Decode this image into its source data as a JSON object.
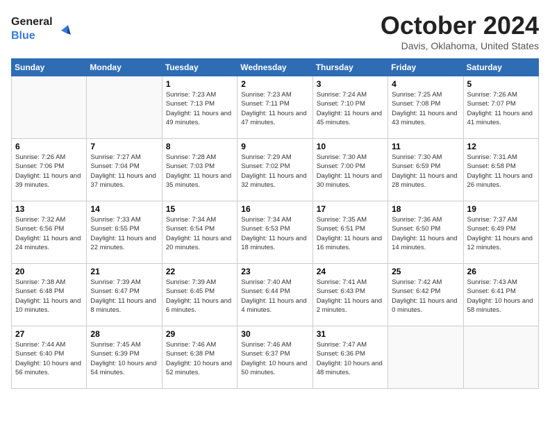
{
  "header": {
    "logo_general": "General",
    "logo_blue": "Blue",
    "title": "October 2024",
    "location": "Davis, Oklahoma, United States"
  },
  "weekdays": [
    "Sunday",
    "Monday",
    "Tuesday",
    "Wednesday",
    "Thursday",
    "Friday",
    "Saturday"
  ],
  "weeks": [
    [
      {
        "day": "",
        "info": ""
      },
      {
        "day": "",
        "info": ""
      },
      {
        "day": "1",
        "info": "Sunrise: 7:23 AM\nSunset: 7:13 PM\nDaylight: 11 hours and 49 minutes."
      },
      {
        "day": "2",
        "info": "Sunrise: 7:23 AM\nSunset: 7:11 PM\nDaylight: 11 hours and 47 minutes."
      },
      {
        "day": "3",
        "info": "Sunrise: 7:24 AM\nSunset: 7:10 PM\nDaylight: 11 hours and 45 minutes."
      },
      {
        "day": "4",
        "info": "Sunrise: 7:25 AM\nSunset: 7:08 PM\nDaylight: 11 hours and 43 minutes."
      },
      {
        "day": "5",
        "info": "Sunrise: 7:26 AM\nSunset: 7:07 PM\nDaylight: 11 hours and 41 minutes."
      }
    ],
    [
      {
        "day": "6",
        "info": "Sunrise: 7:26 AM\nSunset: 7:06 PM\nDaylight: 11 hours and 39 minutes."
      },
      {
        "day": "7",
        "info": "Sunrise: 7:27 AM\nSunset: 7:04 PM\nDaylight: 11 hours and 37 minutes."
      },
      {
        "day": "8",
        "info": "Sunrise: 7:28 AM\nSunset: 7:03 PM\nDaylight: 11 hours and 35 minutes."
      },
      {
        "day": "9",
        "info": "Sunrise: 7:29 AM\nSunset: 7:02 PM\nDaylight: 11 hours and 32 minutes."
      },
      {
        "day": "10",
        "info": "Sunrise: 7:30 AM\nSunset: 7:00 PM\nDaylight: 11 hours and 30 minutes."
      },
      {
        "day": "11",
        "info": "Sunrise: 7:30 AM\nSunset: 6:59 PM\nDaylight: 11 hours and 28 minutes."
      },
      {
        "day": "12",
        "info": "Sunrise: 7:31 AM\nSunset: 6:58 PM\nDaylight: 11 hours and 26 minutes."
      }
    ],
    [
      {
        "day": "13",
        "info": "Sunrise: 7:32 AM\nSunset: 6:56 PM\nDaylight: 11 hours and 24 minutes."
      },
      {
        "day": "14",
        "info": "Sunrise: 7:33 AM\nSunset: 6:55 PM\nDaylight: 11 hours and 22 minutes."
      },
      {
        "day": "15",
        "info": "Sunrise: 7:34 AM\nSunset: 6:54 PM\nDaylight: 11 hours and 20 minutes."
      },
      {
        "day": "16",
        "info": "Sunrise: 7:34 AM\nSunset: 6:53 PM\nDaylight: 11 hours and 18 minutes."
      },
      {
        "day": "17",
        "info": "Sunrise: 7:35 AM\nSunset: 6:51 PM\nDaylight: 11 hours and 16 minutes."
      },
      {
        "day": "18",
        "info": "Sunrise: 7:36 AM\nSunset: 6:50 PM\nDaylight: 11 hours and 14 minutes."
      },
      {
        "day": "19",
        "info": "Sunrise: 7:37 AM\nSunset: 6:49 PM\nDaylight: 11 hours and 12 minutes."
      }
    ],
    [
      {
        "day": "20",
        "info": "Sunrise: 7:38 AM\nSunset: 6:48 PM\nDaylight: 11 hours and 10 minutes."
      },
      {
        "day": "21",
        "info": "Sunrise: 7:39 AM\nSunset: 6:47 PM\nDaylight: 11 hours and 8 minutes."
      },
      {
        "day": "22",
        "info": "Sunrise: 7:39 AM\nSunset: 6:45 PM\nDaylight: 11 hours and 6 minutes."
      },
      {
        "day": "23",
        "info": "Sunrise: 7:40 AM\nSunset: 6:44 PM\nDaylight: 11 hours and 4 minutes."
      },
      {
        "day": "24",
        "info": "Sunrise: 7:41 AM\nSunset: 6:43 PM\nDaylight: 11 hours and 2 minutes."
      },
      {
        "day": "25",
        "info": "Sunrise: 7:42 AM\nSunset: 6:42 PM\nDaylight: 11 hours and 0 minutes."
      },
      {
        "day": "26",
        "info": "Sunrise: 7:43 AM\nSunset: 6:41 PM\nDaylight: 10 hours and 58 minutes."
      }
    ],
    [
      {
        "day": "27",
        "info": "Sunrise: 7:44 AM\nSunset: 6:40 PM\nDaylight: 10 hours and 56 minutes."
      },
      {
        "day": "28",
        "info": "Sunrise: 7:45 AM\nSunset: 6:39 PM\nDaylight: 10 hours and 54 minutes."
      },
      {
        "day": "29",
        "info": "Sunrise: 7:46 AM\nSunset: 6:38 PM\nDaylight: 10 hours and 52 minutes."
      },
      {
        "day": "30",
        "info": "Sunrise: 7:46 AM\nSunset: 6:37 PM\nDaylight: 10 hours and 50 minutes."
      },
      {
        "day": "31",
        "info": "Sunrise: 7:47 AM\nSunset: 6:36 PM\nDaylight: 10 hours and 48 minutes."
      },
      {
        "day": "",
        "info": ""
      },
      {
        "day": "",
        "info": ""
      }
    ]
  ]
}
